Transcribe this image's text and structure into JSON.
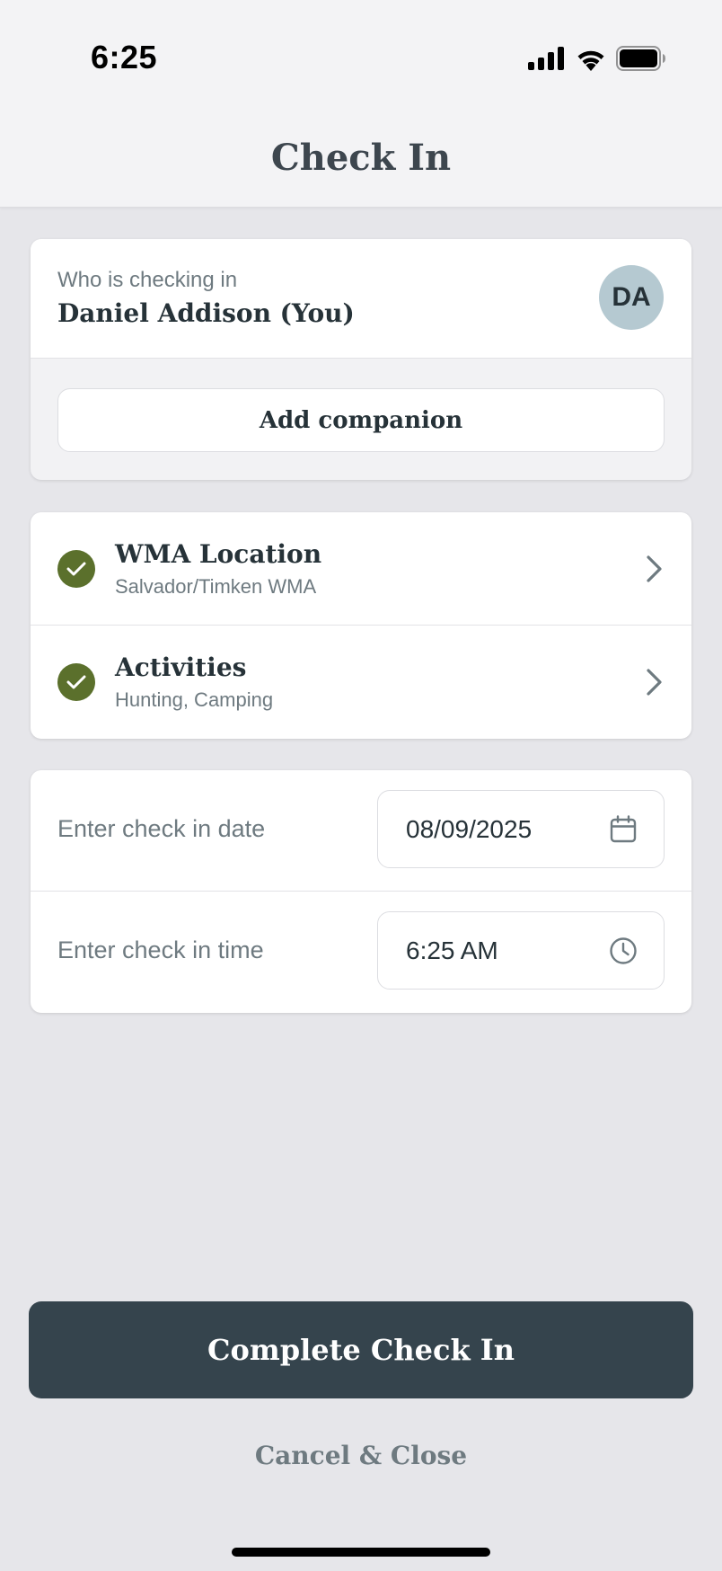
{
  "status_bar": {
    "time": "6:25"
  },
  "header": {
    "title": "Check In"
  },
  "who": {
    "label": "Who is checking in",
    "name": "Daniel Addison (You)",
    "avatar_initials": "DA",
    "add_companion_label": "Add companion"
  },
  "steps": [
    {
      "title": "WMA Location",
      "subtitle": "Salvador/Timken WMA",
      "status": "complete"
    },
    {
      "title": "Activities",
      "subtitle": "Hunting, Camping",
      "status": "complete"
    }
  ],
  "datetime": {
    "date_label": "Enter check in date",
    "date_value": "08/09/2025",
    "time_label": "Enter check in time",
    "time_value": "6:25 AM"
  },
  "actions": {
    "primary_label": "Complete Check In",
    "cancel_label": "Cancel & Close"
  },
  "colors": {
    "accent_green": "#5b702c",
    "primary_button": "#35444d",
    "avatar_bg": "#b5c9d1"
  },
  "icons": {
    "signal": "cellular-signal-icon",
    "wifi": "wifi-icon",
    "battery": "battery-icon",
    "check": "checkmark-icon",
    "chevron": "chevron-right-icon",
    "calendar": "calendar-icon",
    "clock": "clock-icon"
  }
}
